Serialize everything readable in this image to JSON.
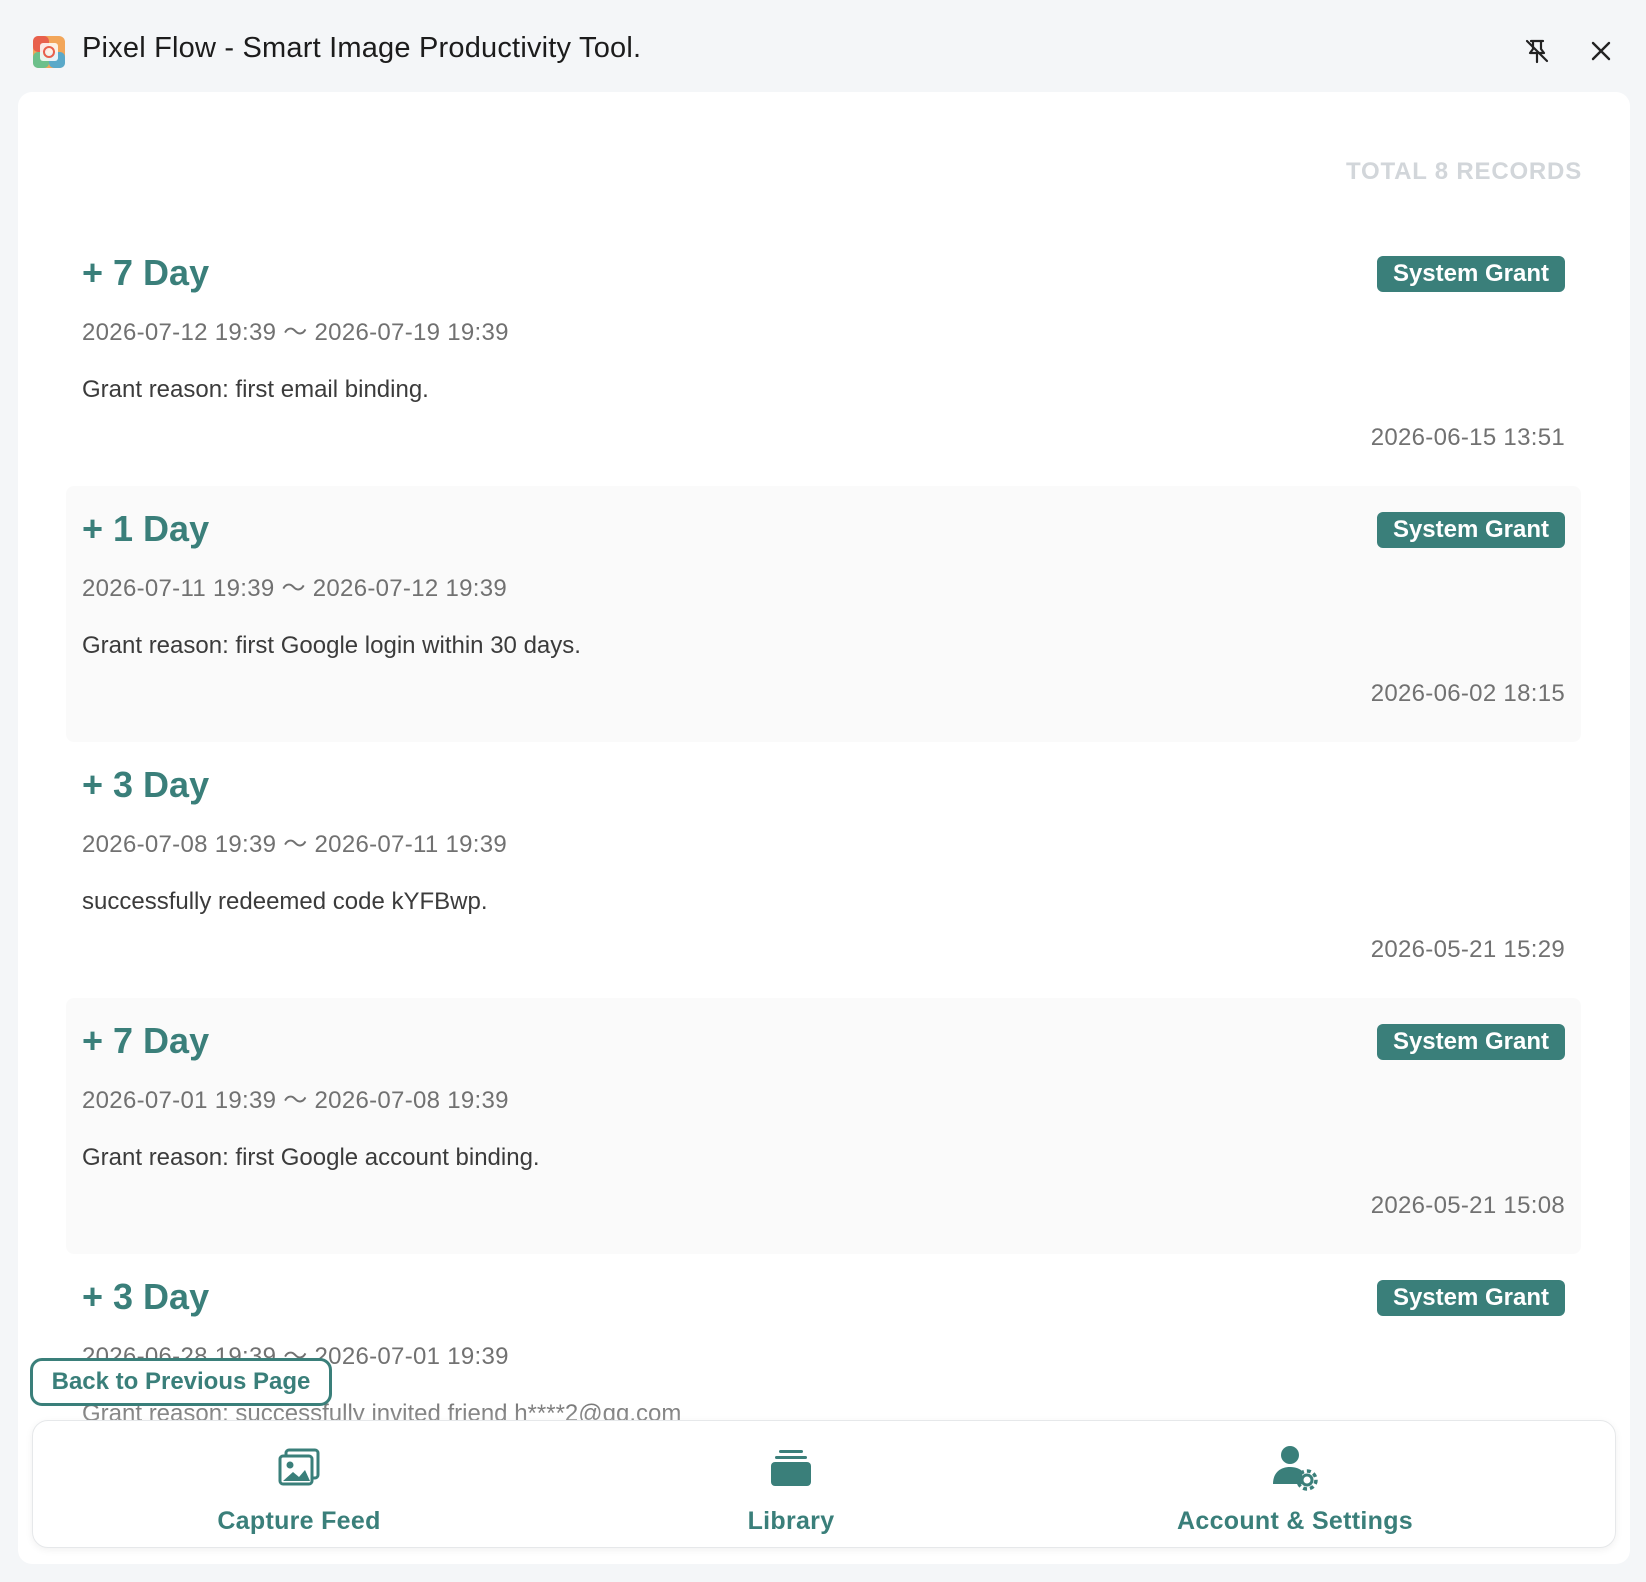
{
  "window": {
    "title": "Pixel Flow - Smart Image Productivity Tool.",
    "icons": {
      "app": "app-logo-icon",
      "pin": "unpin-icon",
      "close": "close-icon"
    }
  },
  "records_header": {
    "total_label": "TOTAL 8 RECORDS"
  },
  "records": [
    {
      "amount": "+ 7 Day",
      "badge": "System Grant",
      "range": "2026-07-12 19:39 ～ 2026-07-19 19:39",
      "reason": "Grant reason: first email binding.",
      "created": "2026-06-15 13:51"
    },
    {
      "amount": "+ 1 Day",
      "badge": "System Grant",
      "range": "2026-07-11 19:39 ～ 2026-07-12 19:39",
      "reason": "Grant reason: first Google login within 30 days.",
      "created": "2026-06-02 18:15"
    },
    {
      "amount": "+ 3 Day",
      "badge": "",
      "range": "2026-07-08 19:39 ～ 2026-07-11 19:39",
      "reason": "successfully redeemed code kYFBwp.",
      "created": "2026-05-21 15:29"
    },
    {
      "amount": "+ 7 Day",
      "badge": "System Grant",
      "range": "2026-07-01 19:39 ～ 2026-07-08 19:39",
      "reason": "Grant reason: first Google account binding.",
      "created": "2026-05-21 15:08"
    },
    {
      "amount": "+ 3 Day",
      "badge": "System Grant",
      "range": "2026-06-28 19:39 ～ 2026-07-01 19:39",
      "reason": "Grant reason: successfully invited friend h****2@qq.com",
      "created": ""
    }
  ],
  "back_button": {
    "label": "Back to Previous Page"
  },
  "bottom_nav": {
    "capture": {
      "label": "Capture Feed",
      "icon": "image-gallery-icon"
    },
    "library": {
      "label": "Library",
      "icon": "stack-folder-icon"
    },
    "account": {
      "label": "Account & Settings",
      "icon": "user-settings-icon"
    }
  },
  "colors": {
    "accent": "#3a7f7a",
    "muted_text": "#717171",
    "total_label": "#d2d6da"
  }
}
